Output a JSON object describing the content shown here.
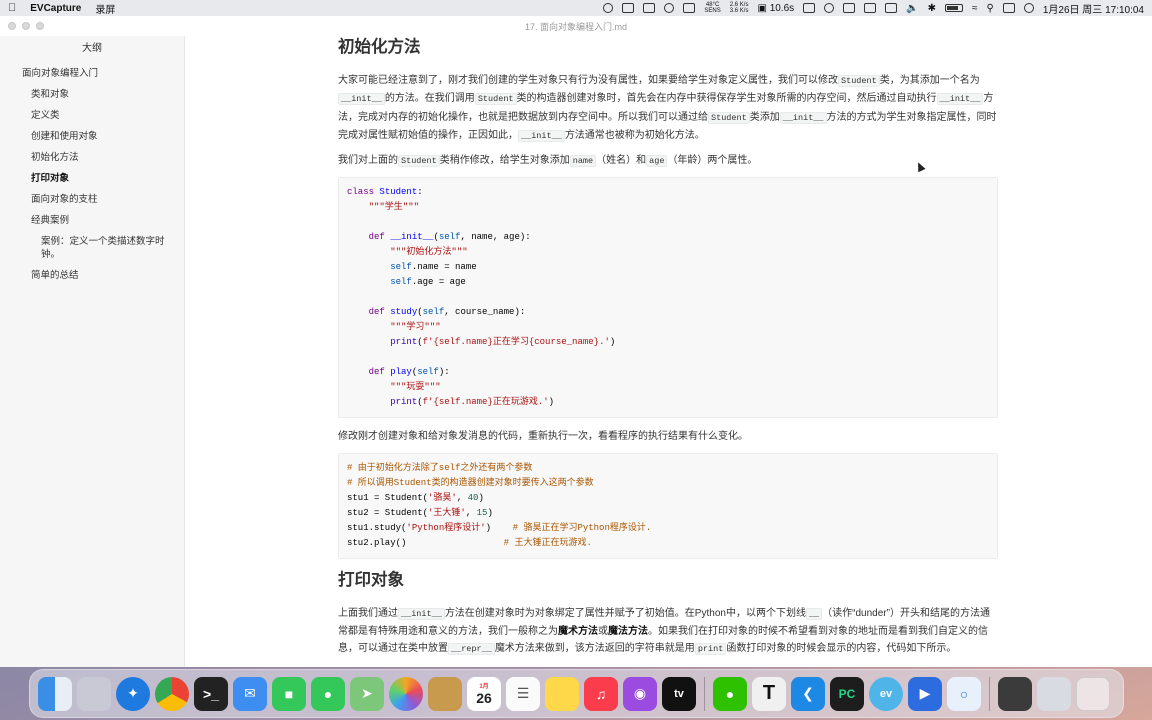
{
  "menubar": {
    "app_name": "EVCapture",
    "menu_item": "录屏",
    "cpu_temp": "48°C",
    "cpu_sub": "SENS",
    "net_up": "2.6 K/s",
    "net_down": "3.6 K/s",
    "timer": "10.6s",
    "date_time": "1月26日 周三 17:10:04"
  },
  "window": {
    "title": "17. 面向对象编程入门.md"
  },
  "sidebar": {
    "title": "大纲",
    "items": [
      {
        "label": "面向对象编程入门"
      },
      {
        "label": "类和对象"
      },
      {
        "label": "定义类"
      },
      {
        "label": "创建和使用对象"
      },
      {
        "label": "初始化方法"
      },
      {
        "label": "打印对象"
      },
      {
        "label": "面向对象的支柱"
      },
      {
        "label": "经典案例"
      },
      {
        "label": "案例：定义一个类描述数字时钟。"
      },
      {
        "label": "简单的总结"
      }
    ]
  },
  "content": {
    "h_init": "初始化方法",
    "p1": {
      "a": "大家可能已经注意到了，刚才我们创建的学生对象只有行为没有属性，如果要给学生对象定义属性，我们可以修改",
      "c1": "Student",
      "b": "类，为其添加一个名为",
      "c2": "__init__",
      "d": "的方法。在我们调用",
      "c3": "Student",
      "e": "类的构造器创建对象时，首先会在内存中获得保存学生对象所需的内存空间，然后通过自动执行",
      "c4": "__init__",
      "f": "方法，完成对内存的初始化操作，也就是把数据放到内存空间中。所以我们可以通过给",
      "c5": "Student",
      "g": "类添加",
      "c6": "__init__",
      "h": "方法的方式为学生对象指定属性，同时完成对属性赋初始值的操作，正因如此，",
      "c7": "__init__",
      "i": "方法通常也被称为初始化方法。"
    },
    "p2": {
      "a": "我们对上面的",
      "c1": "Student",
      "b": "类稍作修改，给学生对象添加",
      "c2": "name",
      "c": "（姓名）和",
      "c3": "age",
      "d": "（年龄）两个属性。"
    },
    "code1": {
      "l1_kw": "class",
      "l1_name": "Student",
      "l2": "\"\"\"学生\"\"\"",
      "l4_kw": "def",
      "l4_name": "__init__",
      "l4_self": "self",
      "l4_rest": ", name, age):",
      "l5": "\"\"\"初始化方法\"\"\"",
      "l6_self": "self",
      "l6_rest": ".name = name",
      "l7_self": "self",
      "l7_rest": ".age = age",
      "l9_kw": "def",
      "l9_name": "study",
      "l9_self": "self",
      "l9_rest": ", course_name):",
      "l10": "\"\"\"学习\"\"\"",
      "l11_fn": "print",
      "l11_str": "f'{self.name}正在学习{course_name}.'",
      "l13_kw": "def",
      "l13_name": "play",
      "l13_self": "self",
      "l14": "\"\"\"玩耍\"\"\"",
      "l15_fn": "print",
      "l15_str": "f'{self.name}正在玩游戏.'"
    },
    "p3": "修改刚才创建对象和给对象发消息的代码，重新执行一次，看看程序的执行结果有什么变化。",
    "code2": {
      "c1": "# 由于初始化方法除了self之外还有两个参数",
      "c2": "# 所以调用Student类的构造器创建对象时要传入这两个参数",
      "l3_a": "stu1 = Student(",
      "l3_s": "'骆昊'",
      "l3_n": "40",
      "l4_a": "stu2 = Student(",
      "l4_s": "'王大锤'",
      "l4_n": "15",
      "l5_a": "stu1.study(",
      "l5_s": "'Python程序设计'",
      "l5_c": "# 骆昊正在学习Python程序设计.",
      "l6_a": "stu2.play()",
      "l6_c": "# 王大锤正在玩游戏."
    },
    "h_print": "打印对象",
    "p4": {
      "a": "上面我们通过",
      "c1": "__init__",
      "b": "方法在创建对象时为对象绑定了属性并赋予了初始值。在Python中，以两个下划线",
      "c2": "__",
      "c": "（读作“dunder”）开头和结尾的方法通常都是有特殊用途和意义的方法，我们一般称之为",
      "s1": "魔术方法",
      "d": "或",
      "s2": "魔法方法",
      "e": "。如果我们在打印对象的时候不希望看到对象的地址而是看到我们自定义的信息，可以通过在类中放置",
      "c3": "__repr__",
      "f": "魔术方法来做到，该方法返回的字符串就是用",
      "c4": "print",
      "g": "函数打印对象的时候会显示的内容，代码如下所示。"
    }
  },
  "dock": {
    "calendar_month": "1月",
    "calendar_day": "26",
    "apps": [
      "finder",
      "launchpad",
      "safari",
      "chrome",
      "terminal",
      "mail",
      "facetime",
      "messages",
      "maps",
      "photos",
      "archive",
      "calendar",
      "reminders",
      "notes",
      "music",
      "podcasts",
      "tv",
      "wechat",
      "typora",
      "vscode",
      "pycharm",
      "evcapture",
      "zoom",
      "qq",
      "downloads",
      "screenshot",
      "trash"
    ]
  }
}
